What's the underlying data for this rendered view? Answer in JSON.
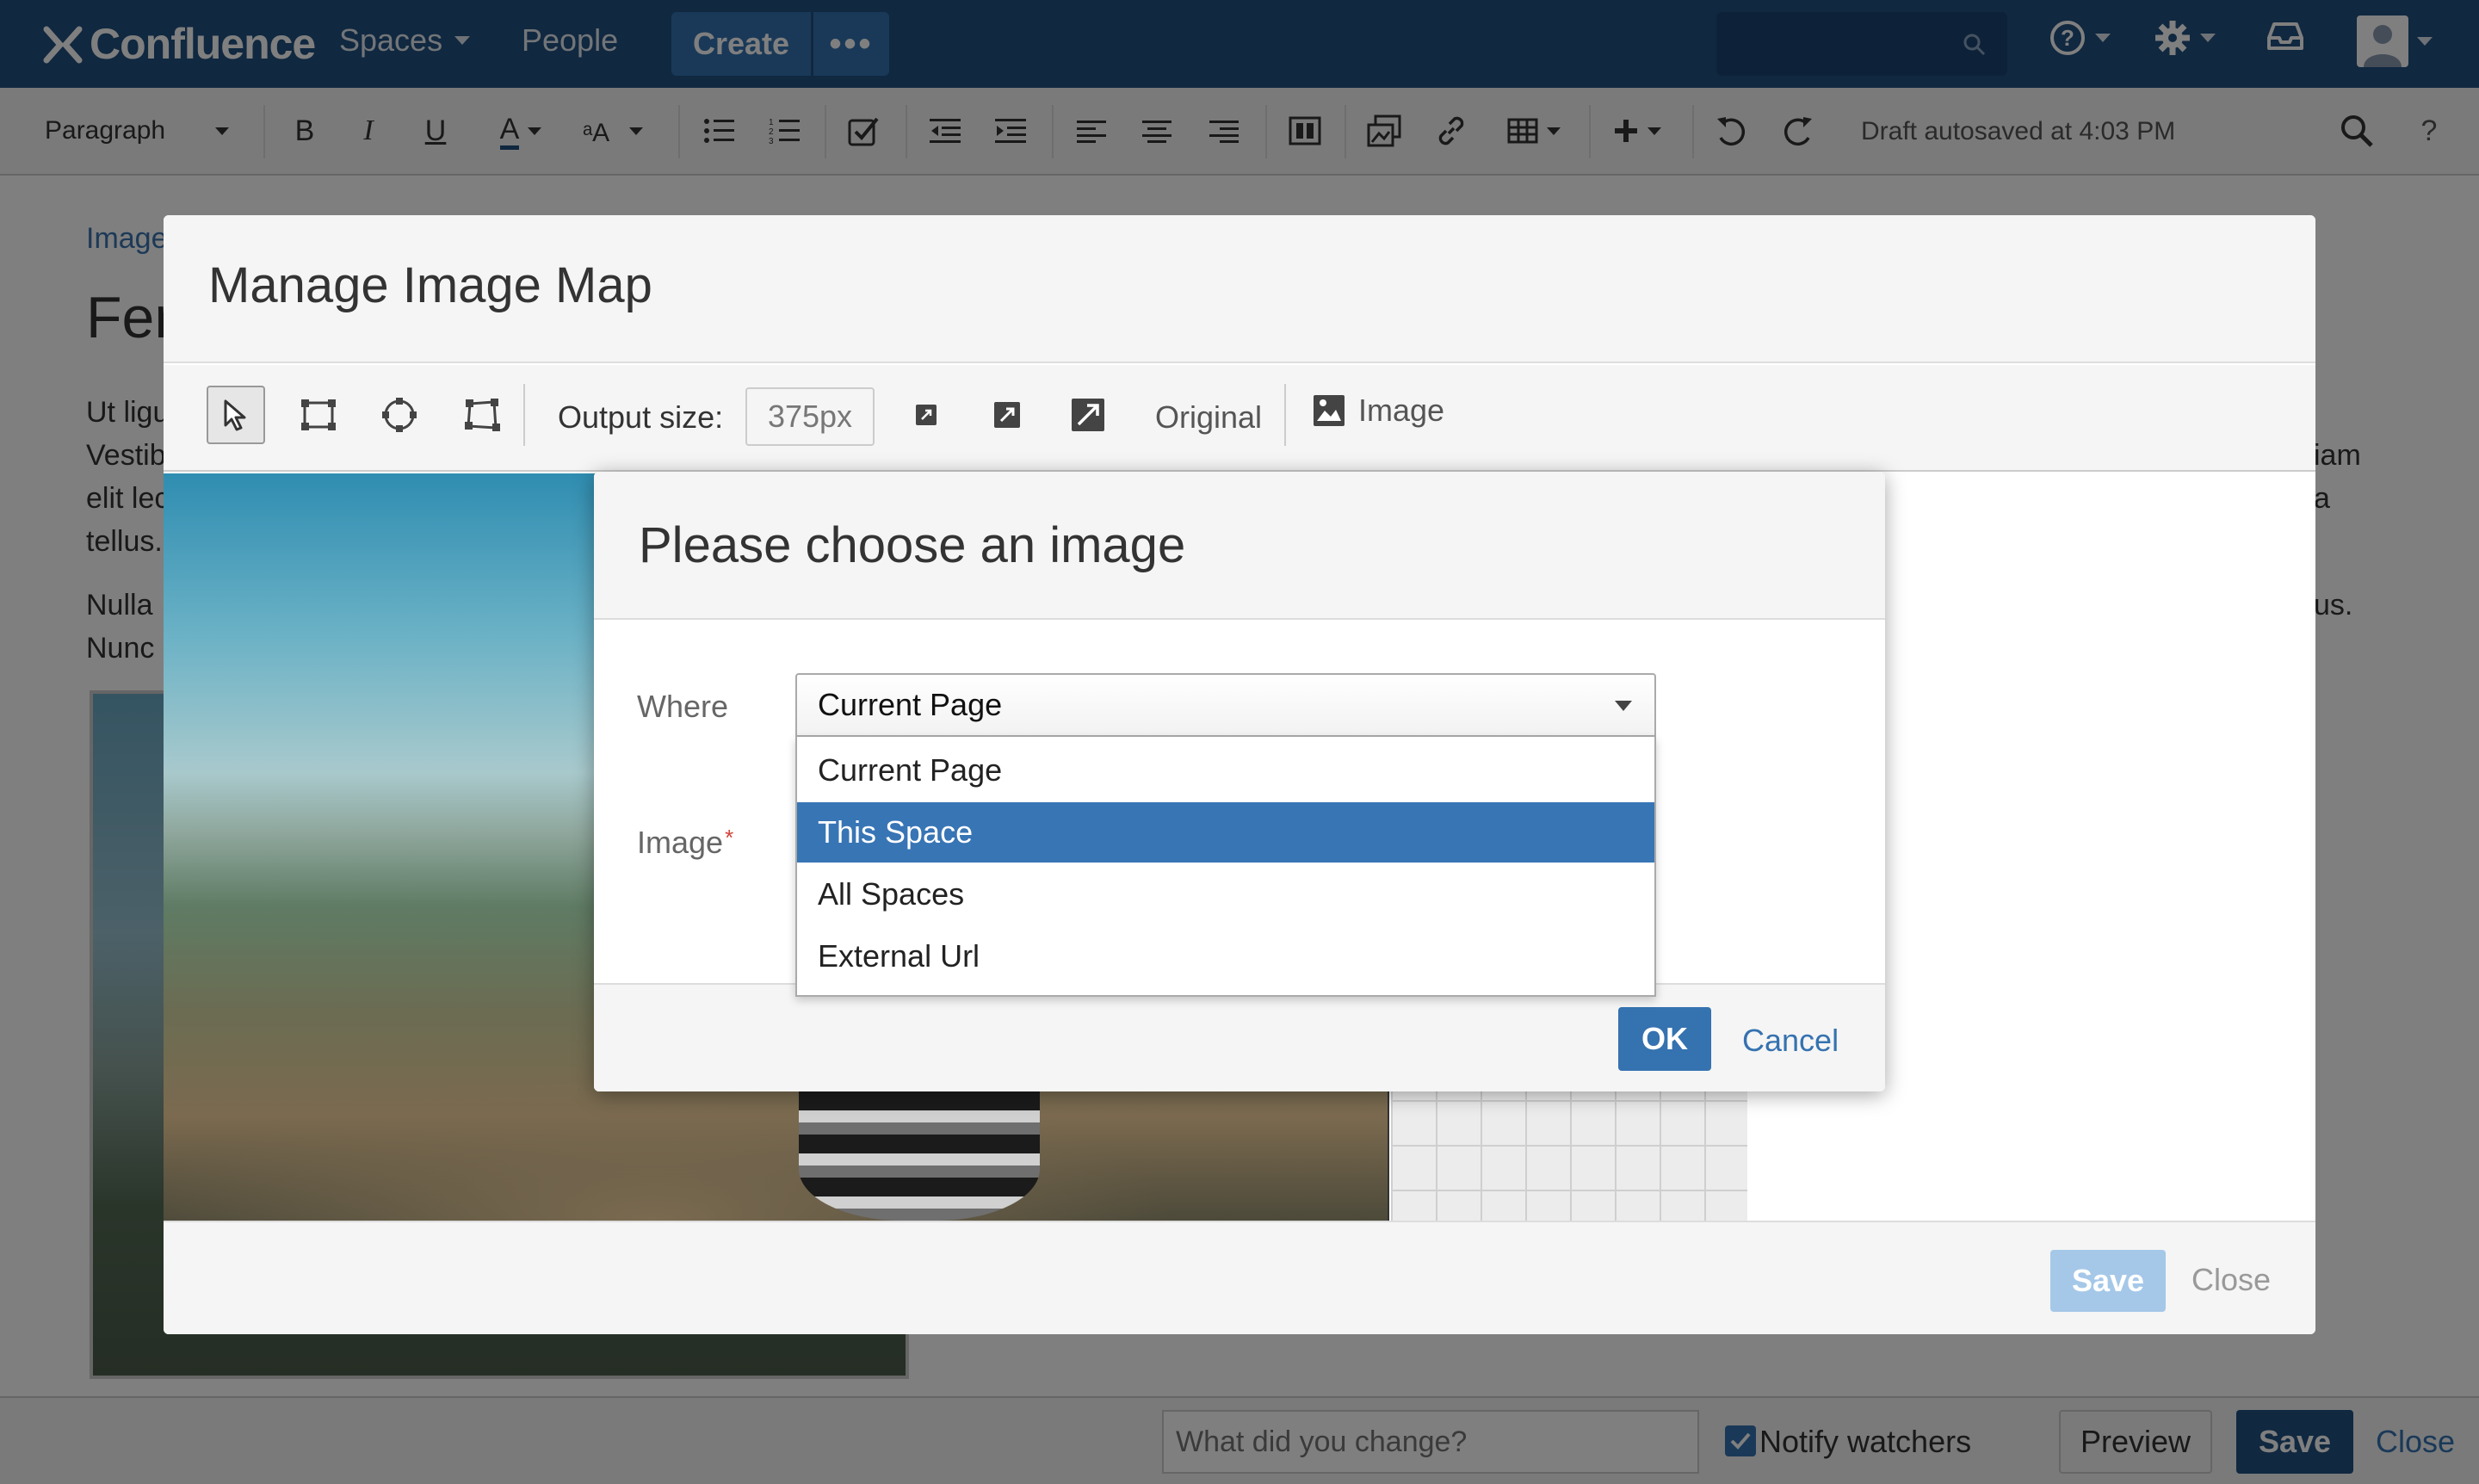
{
  "topnav": {
    "logo": "Confluence",
    "spaces": "Spaces",
    "people": "People",
    "create": "Create",
    "more": "•••",
    "icons": [
      "search-icon",
      "help-icon",
      "gear-icon",
      "notifications-icon",
      "user-avatar-icon"
    ]
  },
  "toolbar": {
    "paragraph": "Paragraph",
    "bold": "B",
    "italic": "I",
    "underline": "U",
    "text_color": "A",
    "draft_status": "Draft autosaved at 4:03 PM",
    "help": "?"
  },
  "page": {
    "breadcrumb": "Image",
    "title": "Fer",
    "para1": [
      "Ut ligu",
      "Vestib",
      "elit lec",
      "tellus."
    ],
    "para2": [
      "Nulla",
      "Nunc"
    ],
    "para1_right": [
      "iam",
      "a"
    ],
    "para2_right": [
      "us."
    ]
  },
  "manage_modal": {
    "title": "Manage Image Map",
    "output_size_label": "Output size:",
    "output_size_value": "375px",
    "original": "Original",
    "image": "Image",
    "save": "Save",
    "close": "Close"
  },
  "choose_modal": {
    "title": "Please choose an image",
    "where_label": "Where",
    "image_label": "Image",
    "required_mark": "*",
    "selected_value": "Current Page",
    "options": [
      "Current Page",
      "This Space",
      "All Spaces",
      "External Url"
    ],
    "highlighted_option": "This Space",
    "ok": "OK",
    "cancel": "Cancel"
  },
  "bottombar": {
    "change_placeholder": "What did you change?",
    "notify": "Notify watchers",
    "preview": "Preview",
    "save": "Save",
    "close": "Close"
  },
  "colors": {
    "nav_bg": "#205081",
    "primary": "#3572b0",
    "highlight": "#3875b5"
  }
}
